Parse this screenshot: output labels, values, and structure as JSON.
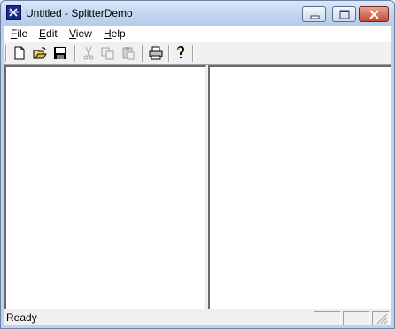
{
  "window": {
    "title": "Untitled - SplitterDemo",
    "icon": "app-icon"
  },
  "menu": {
    "items": [
      {
        "accel": "F",
        "rest": "ile"
      },
      {
        "accel": "E",
        "rest": "dit"
      },
      {
        "accel": "V",
        "rest": "iew"
      },
      {
        "accel": "H",
        "rest": "elp"
      }
    ]
  },
  "toolbar": {
    "buttons": [
      {
        "name": "new-file",
        "icon": "new-document-icon",
        "enabled": true
      },
      {
        "name": "open",
        "icon": "open-folder-icon",
        "enabled": true
      },
      {
        "name": "save",
        "icon": "floppy-disk-icon",
        "enabled": true
      },
      {
        "name": "cut",
        "icon": "scissors-icon",
        "enabled": false
      },
      {
        "name": "copy",
        "icon": "copy-icon",
        "enabled": false
      },
      {
        "name": "paste",
        "icon": "paste-icon",
        "enabled": false
      },
      {
        "name": "print",
        "icon": "printer-icon",
        "enabled": true
      },
      {
        "name": "help",
        "icon": "help-question-icon",
        "enabled": true
      }
    ]
  },
  "status": {
    "text": "Ready"
  },
  "colors": {
    "titlebar": "#c3d7f0",
    "close_button": "#c54a30",
    "pane_background": "#ffffff"
  }
}
